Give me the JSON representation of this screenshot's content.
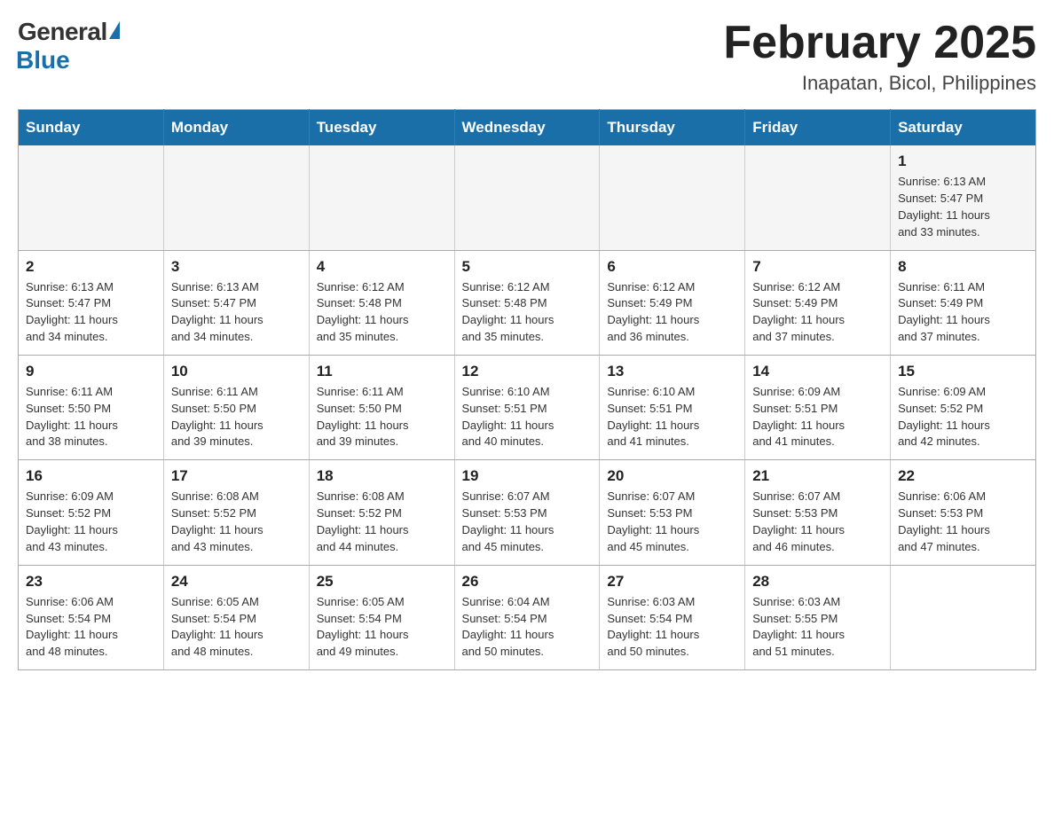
{
  "header": {
    "logo_general": "General",
    "logo_blue": "Blue",
    "month_title": "February 2025",
    "location": "Inapatan, Bicol, Philippines"
  },
  "weekdays": [
    "Sunday",
    "Monday",
    "Tuesday",
    "Wednesday",
    "Thursday",
    "Friday",
    "Saturday"
  ],
  "weeks": [
    {
      "days": [
        {
          "number": "",
          "info": ""
        },
        {
          "number": "",
          "info": ""
        },
        {
          "number": "",
          "info": ""
        },
        {
          "number": "",
          "info": ""
        },
        {
          "number": "",
          "info": ""
        },
        {
          "number": "",
          "info": ""
        },
        {
          "number": "1",
          "info": "Sunrise: 6:13 AM\nSunset: 5:47 PM\nDaylight: 11 hours\nand 33 minutes."
        }
      ]
    },
    {
      "days": [
        {
          "number": "2",
          "info": "Sunrise: 6:13 AM\nSunset: 5:47 PM\nDaylight: 11 hours\nand 34 minutes."
        },
        {
          "number": "3",
          "info": "Sunrise: 6:13 AM\nSunset: 5:47 PM\nDaylight: 11 hours\nand 34 minutes."
        },
        {
          "number": "4",
          "info": "Sunrise: 6:12 AM\nSunset: 5:48 PM\nDaylight: 11 hours\nand 35 minutes."
        },
        {
          "number": "5",
          "info": "Sunrise: 6:12 AM\nSunset: 5:48 PM\nDaylight: 11 hours\nand 35 minutes."
        },
        {
          "number": "6",
          "info": "Sunrise: 6:12 AM\nSunset: 5:49 PM\nDaylight: 11 hours\nand 36 minutes."
        },
        {
          "number": "7",
          "info": "Sunrise: 6:12 AM\nSunset: 5:49 PM\nDaylight: 11 hours\nand 37 minutes."
        },
        {
          "number": "8",
          "info": "Sunrise: 6:11 AM\nSunset: 5:49 PM\nDaylight: 11 hours\nand 37 minutes."
        }
      ]
    },
    {
      "days": [
        {
          "number": "9",
          "info": "Sunrise: 6:11 AM\nSunset: 5:50 PM\nDaylight: 11 hours\nand 38 minutes."
        },
        {
          "number": "10",
          "info": "Sunrise: 6:11 AM\nSunset: 5:50 PM\nDaylight: 11 hours\nand 39 minutes."
        },
        {
          "number": "11",
          "info": "Sunrise: 6:11 AM\nSunset: 5:50 PM\nDaylight: 11 hours\nand 39 minutes."
        },
        {
          "number": "12",
          "info": "Sunrise: 6:10 AM\nSunset: 5:51 PM\nDaylight: 11 hours\nand 40 minutes."
        },
        {
          "number": "13",
          "info": "Sunrise: 6:10 AM\nSunset: 5:51 PM\nDaylight: 11 hours\nand 41 minutes."
        },
        {
          "number": "14",
          "info": "Sunrise: 6:09 AM\nSunset: 5:51 PM\nDaylight: 11 hours\nand 41 minutes."
        },
        {
          "number": "15",
          "info": "Sunrise: 6:09 AM\nSunset: 5:52 PM\nDaylight: 11 hours\nand 42 minutes."
        }
      ]
    },
    {
      "days": [
        {
          "number": "16",
          "info": "Sunrise: 6:09 AM\nSunset: 5:52 PM\nDaylight: 11 hours\nand 43 minutes."
        },
        {
          "number": "17",
          "info": "Sunrise: 6:08 AM\nSunset: 5:52 PM\nDaylight: 11 hours\nand 43 minutes."
        },
        {
          "number": "18",
          "info": "Sunrise: 6:08 AM\nSunset: 5:52 PM\nDaylight: 11 hours\nand 44 minutes."
        },
        {
          "number": "19",
          "info": "Sunrise: 6:07 AM\nSunset: 5:53 PM\nDaylight: 11 hours\nand 45 minutes."
        },
        {
          "number": "20",
          "info": "Sunrise: 6:07 AM\nSunset: 5:53 PM\nDaylight: 11 hours\nand 45 minutes."
        },
        {
          "number": "21",
          "info": "Sunrise: 6:07 AM\nSunset: 5:53 PM\nDaylight: 11 hours\nand 46 minutes."
        },
        {
          "number": "22",
          "info": "Sunrise: 6:06 AM\nSunset: 5:53 PM\nDaylight: 11 hours\nand 47 minutes."
        }
      ]
    },
    {
      "days": [
        {
          "number": "23",
          "info": "Sunrise: 6:06 AM\nSunset: 5:54 PM\nDaylight: 11 hours\nand 48 minutes."
        },
        {
          "number": "24",
          "info": "Sunrise: 6:05 AM\nSunset: 5:54 PM\nDaylight: 11 hours\nand 48 minutes."
        },
        {
          "number": "25",
          "info": "Sunrise: 6:05 AM\nSunset: 5:54 PM\nDaylight: 11 hours\nand 49 minutes."
        },
        {
          "number": "26",
          "info": "Sunrise: 6:04 AM\nSunset: 5:54 PM\nDaylight: 11 hours\nand 50 minutes."
        },
        {
          "number": "27",
          "info": "Sunrise: 6:03 AM\nSunset: 5:54 PM\nDaylight: 11 hours\nand 50 minutes."
        },
        {
          "number": "28",
          "info": "Sunrise: 6:03 AM\nSunset: 5:55 PM\nDaylight: 11 hours\nand 51 minutes."
        },
        {
          "number": "",
          "info": ""
        }
      ]
    }
  ]
}
